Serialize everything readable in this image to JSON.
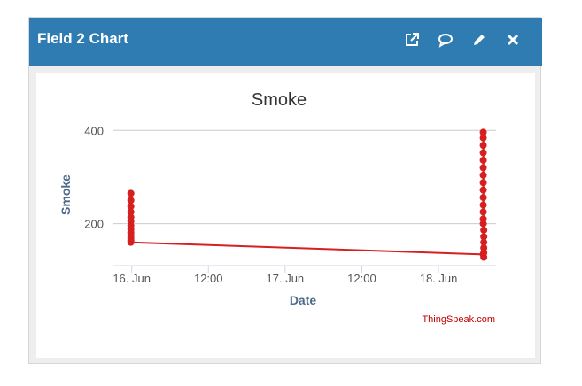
{
  "widget": {
    "title": "Field 2 Chart",
    "tools": [
      {
        "name": "external-link-icon"
      },
      {
        "name": "comment-icon"
      },
      {
        "name": "pencil-icon"
      },
      {
        "name": "close-icon"
      }
    ]
  },
  "colors": {
    "header": "#2f7cb3",
    "series": "#d62020",
    "credit": "#c00000"
  },
  "chart_data": {
    "type": "line",
    "title": "Smoke",
    "xlabel": "Date",
    "ylabel": "Smoke",
    "xlim": [
      "2024-06-15T21:00",
      "2024-06-18T09:00"
    ],
    "ylim": [
      110,
      410
    ],
    "y_ticks": [
      200,
      400
    ],
    "x_ticks": [
      {
        "label": "16. Jun",
        "t": "2024-06-16T00:00"
      },
      {
        "label": "12:00",
        "t": "2024-06-16T12:00"
      },
      {
        "label": "17. Jun",
        "t": "2024-06-17T00:00"
      },
      {
        "label": "12:00",
        "t": "2024-06-17T12:00"
      },
      {
        "label": "18. Jun",
        "t": "2024-06-18T00:00"
      }
    ],
    "grid": true,
    "credit": "ThingSpeak.com",
    "series": [
      {
        "points": [
          {
            "t": "2024-06-15T23:52",
            "y": 265
          },
          {
            "t": "2024-06-15T23:52",
            "y": 250
          },
          {
            "t": "2024-06-15T23:52",
            "y": 237
          },
          {
            "t": "2024-06-15T23:52",
            "y": 225
          },
          {
            "t": "2024-06-15T23:52",
            "y": 214
          },
          {
            "t": "2024-06-15T23:52",
            "y": 205
          },
          {
            "t": "2024-06-15T23:52",
            "y": 196
          },
          {
            "t": "2024-06-15T23:52",
            "y": 188
          },
          {
            "t": "2024-06-15T23:52",
            "y": 181
          },
          {
            "t": "2024-06-15T23:52",
            "y": 175
          },
          {
            "t": "2024-06-15T23:52",
            "y": 169
          },
          {
            "t": "2024-06-15T23:52",
            "y": 164
          },
          {
            "t": "2024-06-15T23:52",
            "y": 160
          },
          {
            "t": "2024-06-18T07:00",
            "y": 134
          },
          {
            "t": "2024-06-18T07:05",
            "y": 128
          },
          {
            "t": "2024-06-18T07:05",
            "y": 138
          },
          {
            "t": "2024-06-18T07:05",
            "y": 148
          },
          {
            "t": "2024-06-18T07:05",
            "y": 160
          },
          {
            "t": "2024-06-18T07:05",
            "y": 172
          },
          {
            "t": "2024-06-18T07:05",
            "y": 186
          },
          {
            "t": "2024-06-18T07:00",
            "y": 200
          },
          {
            "t": "2024-06-18T07:00",
            "y": 210
          },
          {
            "t": "2024-06-18T07:00",
            "y": 225
          },
          {
            "t": "2024-06-18T07:00",
            "y": 240
          },
          {
            "t": "2024-06-18T07:00",
            "y": 256
          },
          {
            "t": "2024-06-18T07:00",
            "y": 272
          },
          {
            "t": "2024-06-18T07:00",
            "y": 288
          },
          {
            "t": "2024-06-18T07:00",
            "y": 304
          },
          {
            "t": "2024-06-18T07:00",
            "y": 320
          },
          {
            "t": "2024-06-18T07:00",
            "y": 336
          },
          {
            "t": "2024-06-18T07:00",
            "y": 352
          },
          {
            "t": "2024-06-18T07:00",
            "y": 368
          },
          {
            "t": "2024-06-18T07:00",
            "y": 384
          },
          {
            "t": "2024-06-18T07:00",
            "y": 396
          }
        ]
      }
    ]
  }
}
